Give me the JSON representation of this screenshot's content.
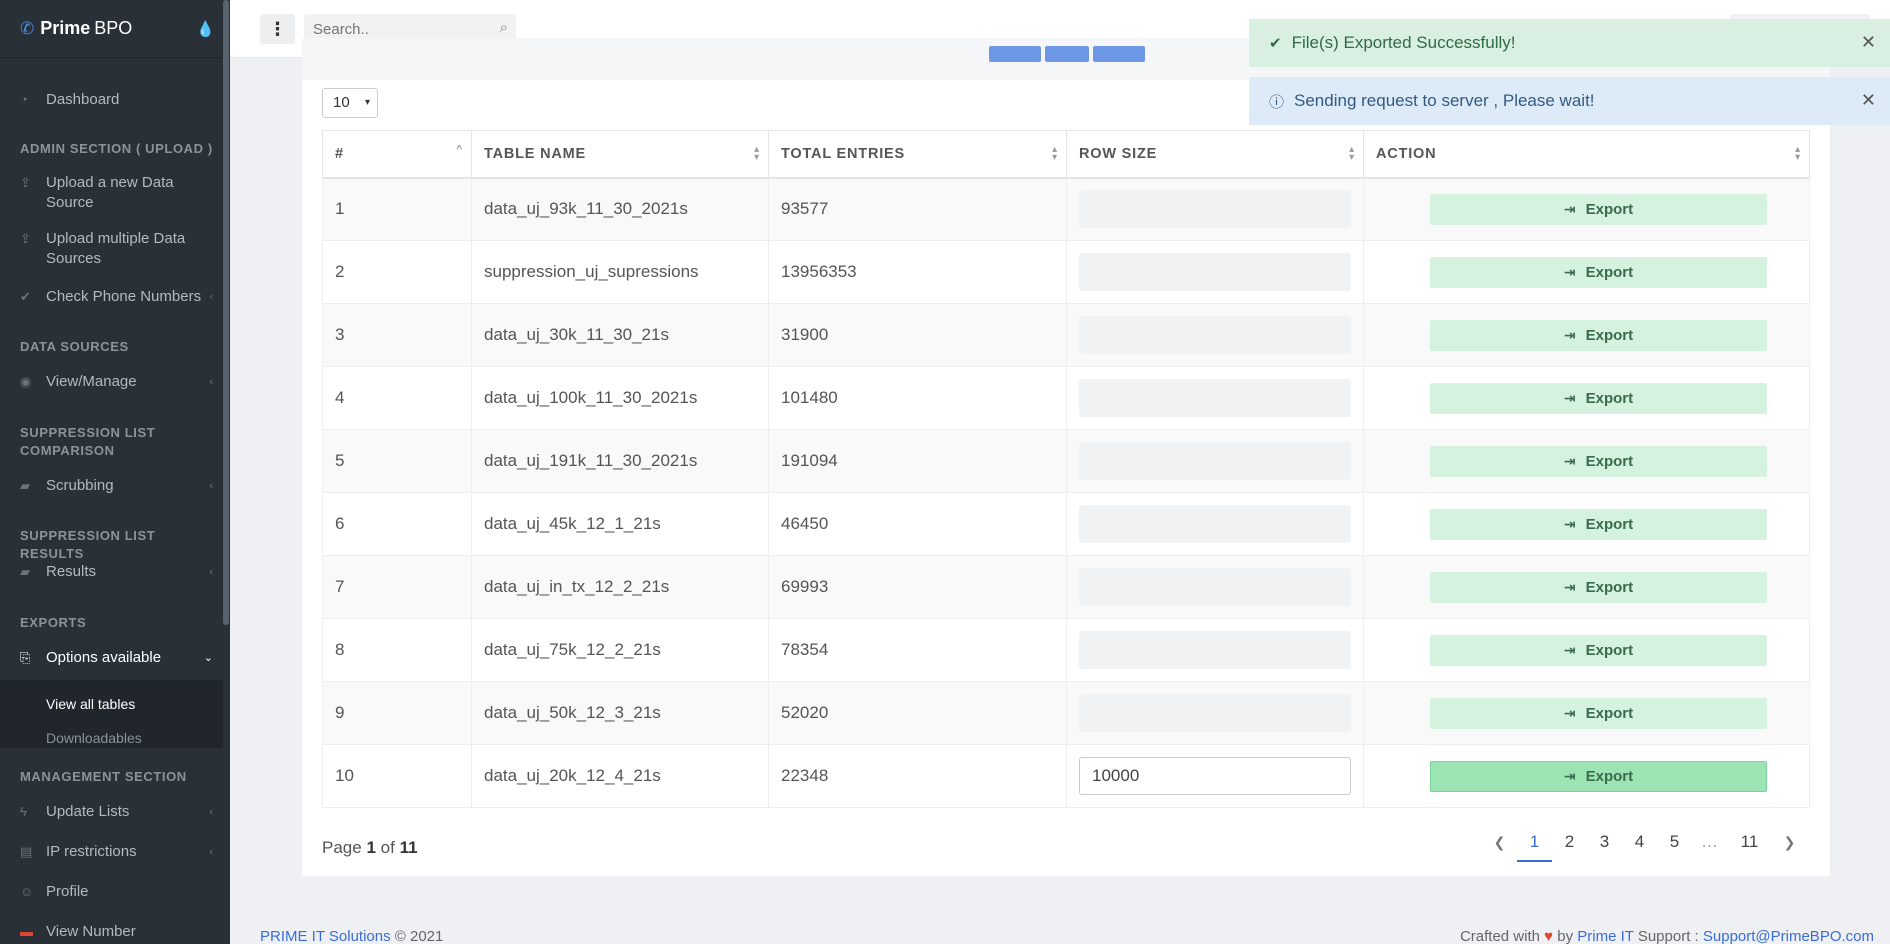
{
  "brand": {
    "name": "Prime",
    "sub": "BPO"
  },
  "sidebar": {
    "dashboard": "Dashboard",
    "admin_head": "ADMIN SECTION ( UPLOAD )",
    "upload_new": "Upload a new Data Source",
    "upload_multi": "Upload multiple Data Sources",
    "check_phone": "Check Phone Numbers",
    "datasources_head": "DATA SOURCES",
    "view_manage": "View/Manage",
    "suppression_head": "SUPPRESSION LIST COMPARISON",
    "scrubbing": "Scrubbing",
    "results_head": "SUPPRESSION LIST RESULTS",
    "results": "Results",
    "exports_head": "EXPORTS",
    "options": "Options available",
    "view_all_tables": "View all tables",
    "downloadables": "Downloadables",
    "management_head": "MANAGEMENT SECTION",
    "update_lists": "Update Lists",
    "ip_restrictions": "IP restrictions",
    "profile": "Profile",
    "view_number": "View Number"
  },
  "search": {
    "placeholder": "Search.."
  },
  "table": {
    "length": "10",
    "headers": [
      "#",
      "TABLE NAME",
      "TOTAL ENTRIES",
      "ROW SIZE",
      "ACTION"
    ],
    "export_label": "Export",
    "rows": [
      {
        "n": "1",
        "name": "data_uj_93k_11_30_2021s",
        "total": "93577",
        "rowsize": ""
      },
      {
        "n": "2",
        "name": "suppression_uj_supressions",
        "total": "13956353",
        "rowsize": ""
      },
      {
        "n": "3",
        "name": "data_uj_30k_11_30_21s",
        "total": "31900",
        "rowsize": ""
      },
      {
        "n": "4",
        "name": "data_uj_100k_11_30_2021s",
        "total": "101480",
        "rowsize": ""
      },
      {
        "n": "5",
        "name": "data_uj_191k_11_30_2021s",
        "total": "191094",
        "rowsize": ""
      },
      {
        "n": "6",
        "name": "data_uj_45k_12_1_21s",
        "total": "46450",
        "rowsize": ""
      },
      {
        "n": "7",
        "name": "data_uj_in_tx_12_2_21s",
        "total": "69993",
        "rowsize": ""
      },
      {
        "n": "8",
        "name": "data_uj_75k_12_2_21s",
        "total": "78354",
        "rowsize": ""
      },
      {
        "n": "9",
        "name": "data_uj_50k_12_3_21s",
        "total": "52020",
        "rowsize": ""
      },
      {
        "n": "10",
        "name": "data_uj_20k_12_4_21s",
        "total": "22348",
        "rowsize": "10000"
      }
    ]
  },
  "pagination": {
    "page_word": "Page",
    "current": "1",
    "of_word": "of",
    "total": "11",
    "pages": [
      "1",
      "2",
      "3",
      "4",
      "5",
      "…",
      "11"
    ]
  },
  "footer": {
    "company": "PRIME IT Solutions",
    "copyright": "© 2021",
    "crafted": "Crafted with",
    "by": "by",
    "prime_it": "Prime IT",
    "support_label": "Support :",
    "support_email": "Support@PrimeBPO.com"
  },
  "toasts": {
    "success": "File(s) Exported Successfully!",
    "info": "Sending request to server , Please wait!"
  },
  "colors": {
    "sidebar": "#293038",
    "accent": "#3b6dd8",
    "export": "#d4f2de",
    "success_toast": "#d9efe1",
    "info_toast": "#ddebf8"
  }
}
